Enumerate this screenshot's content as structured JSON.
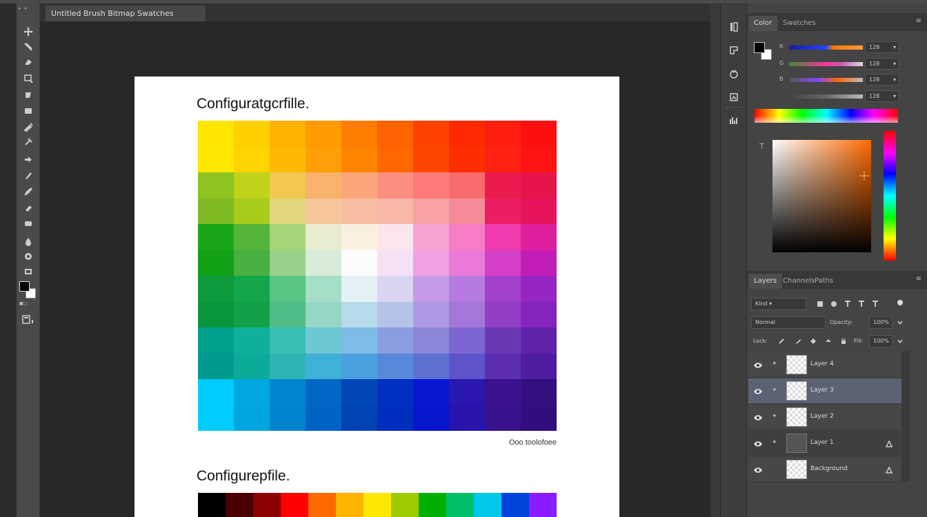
{
  "window": {
    "doc_tab_title": "Untitled Brush Bitmap Swatches"
  },
  "document": {
    "title_1": "Configuratgcrfille.",
    "caption": "Ooo toolofoee",
    "title_2": "Configurepfile."
  },
  "grid_colors": [
    [
      "#ffe600",
      "#ffd000",
      "#ffb200",
      "#ff9a00",
      "#ff7d00",
      "#ff6200",
      "#ff4200",
      "#ff2a00",
      "#ff1e10",
      "#ff1010"
    ],
    [
      "#ffe800",
      "#ffd400",
      "#ffb806",
      "#ff9f08",
      "#ff8400",
      "#ff6800",
      "#ff4600",
      "#ff2e00",
      "#ff2214",
      "#ff1414"
    ],
    [
      "#8fc31f",
      "#c1d21a",
      "#f2c84f",
      "#f8b26b",
      "#fba57b",
      "#fc8f7f",
      "#fc7a77",
      "#f86c6e",
      "#ea1c4d",
      "#e7144c"
    ],
    [
      "#7fbb24",
      "#a8cc1c",
      "#e1d77e",
      "#f5c59b",
      "#f8bca2",
      "#f9b7a8",
      "#f7a2a5",
      "#f78b99",
      "#ec1e63",
      "#e5145c"
    ],
    [
      "#19a719",
      "#55b53b",
      "#a5d478",
      "#e9ecd0",
      "#faf0e0",
      "#fbe6ee",
      "#f9a3d3",
      "#f87bc6",
      "#ef3bad",
      "#e01f9e"
    ],
    [
      "#10a114",
      "#48b040",
      "#97d189",
      "#d8ecd8",
      "#fcfcfc",
      "#f5e1f5",
      "#f0a1e3",
      "#e97ad8",
      "#d640c8",
      "#c31db8"
    ],
    [
      "#0d9b3b",
      "#14a64a",
      "#5ac484",
      "#a6dfc7",
      "#e4f2f6",
      "#dad5f0",
      "#c49ae8",
      "#b67ae0",
      "#a440cc",
      "#9626c2"
    ],
    [
      "#0a963c",
      "#12a148",
      "#50bd86",
      "#95d6c4",
      "#b8dbeb",
      "#b4c3ea",
      "#ad9ae2",
      "#a277d8",
      "#923ec7",
      "#8524bd"
    ],
    [
      "#009f8e",
      "#0fb09a",
      "#3abfb5",
      "#6ec7d5",
      "#80bde6",
      "#8a9de0",
      "#8a86da",
      "#7d66d2",
      "#6b38b5",
      "#5f22a8"
    ],
    [
      "#009a8e",
      "#0cab99",
      "#2fb4b6",
      "#3fb0d8",
      "#4aa0dc",
      "#5788d9",
      "#5e72d4",
      "#5d54cc",
      "#5a2eae",
      "#4f1ca2"
    ],
    [
      "#00ccff",
      "#00a7e0",
      "#0085d1",
      "#0066c6",
      "#0046b6",
      "#0030c2",
      "#0818cf",
      "#2a16b0",
      "#3a128f",
      "#330f80"
    ],
    [
      "#00ccff",
      "#00a6df",
      "#0083cf",
      "#0063c3",
      "#0043b3",
      "#002ebf",
      "#0616cc",
      "#2814ad",
      "#38118d",
      "#310e7e"
    ]
  ],
  "strip_colors": [
    "#000000",
    "#4a0000",
    "#8c0000",
    "#ff0000",
    "#ff6a00",
    "#ffb400",
    "#ffe800",
    "#9ccc00",
    "#00b000",
    "#00c06a",
    "#00c8e8",
    "#0044dd",
    "#8a1cff"
  ],
  "dock": {
    "icons": [
      "layers-icon",
      "history-icon",
      "adjustments-icon",
      "properties-icon",
      "channels-icon"
    ]
  },
  "color_panel": {
    "tabs": [
      "Color",
      "Swatches"
    ],
    "active_tab": 0,
    "menu": "≡",
    "sliders": [
      {
        "label": "R",
        "value": "128"
      },
      {
        "label": "G",
        "value": "128"
      },
      {
        "label": "B",
        "value": "128"
      },
      {
        "label": "",
        "value": "128"
      }
    ]
  },
  "layers_panel": {
    "tabs": [
      "Layers",
      "Channels",
      "Paths"
    ],
    "active_tab": 0,
    "menu": "≡",
    "kind_filter": "Kind",
    "blend_mode": "Normal",
    "opacity_label": "Opacity:",
    "opacity_value": "100%",
    "lock_label": "Lock:",
    "fill_label": "Fill:",
    "fill_value": "100%",
    "layers": [
      {
        "name": "Layer 4",
        "selected": false,
        "thumb": "transparent",
        "fx": false
      },
      {
        "name": "Layer 3",
        "selected": true,
        "thumb": "transparent",
        "fx": false
      },
      {
        "name": "Layer 2",
        "selected": false,
        "thumb": "transparent",
        "fx": false
      },
      {
        "name": "Layer 1",
        "selected": false,
        "thumb": "dark",
        "fx": true
      },
      {
        "name": "Background",
        "selected": false,
        "thumb": "transparent",
        "fx": true
      }
    ]
  }
}
